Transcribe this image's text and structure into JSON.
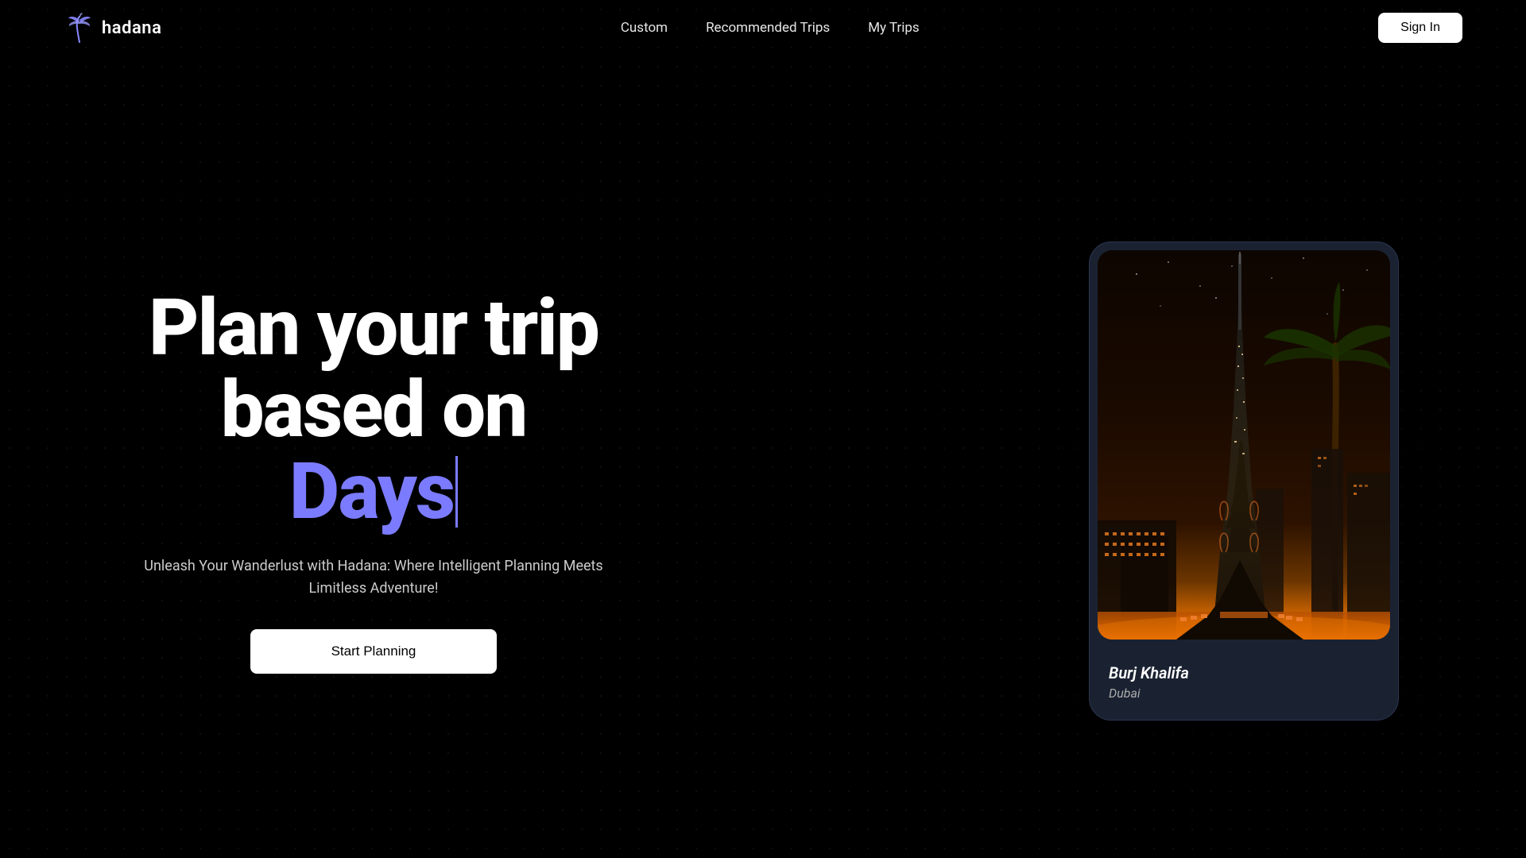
{
  "brand": {
    "name": "hadana",
    "logo_alt": "hadana logo"
  },
  "navbar": {
    "links": [
      {
        "id": "custom",
        "label": "Custom"
      },
      {
        "id": "recommended-trips",
        "label": "Recommended Trips"
      },
      {
        "id": "my-trips",
        "label": "My Trips"
      }
    ],
    "sign_in_label": "Sign In"
  },
  "hero": {
    "heading_line1": "Plan your trip",
    "heading_line2": "based on",
    "heading_animated": "Days",
    "subtitle": "Unleash Your Wanderlust with Hadana: Where Intelligent Planning Meets Limitless Adventure!",
    "cta_label": "Start Planning"
  },
  "destination_card": {
    "landmark": "Burj Khalifa",
    "city": "Dubai"
  },
  "colors": {
    "accent": "#7b7bff",
    "background": "#000000",
    "card_bg": "#1a2232"
  }
}
